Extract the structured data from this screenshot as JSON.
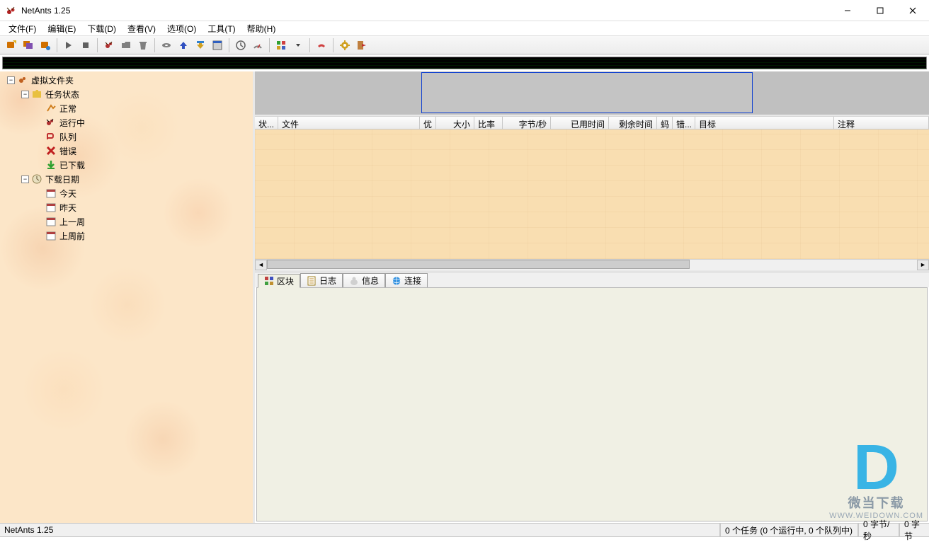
{
  "window": {
    "title": "NetAnts 1.25"
  },
  "menu": {
    "file": "文件(F)",
    "edit": "编辑(E)",
    "download": "下载(D)",
    "view": "查看(V)",
    "options": "选项(O)",
    "tools": "工具(T)",
    "help": "帮助(H)"
  },
  "tree": {
    "root": "虚拟文件夹",
    "task_status": "任务状态",
    "status_items": {
      "normal": "正常",
      "running": "运行中",
      "queued": "队列",
      "error": "错误",
      "downloaded": "已下载"
    },
    "download_date": "下载日期",
    "date_items": {
      "today": "今天",
      "yesterday": "昨天",
      "last_week": "上一周",
      "before_last_week": "上周前"
    }
  },
  "columns": {
    "status": "状...",
    "file": "文件",
    "priority": "优",
    "size": "大小",
    "ratio": "比率",
    "bytes_per_sec": "字节/秒",
    "elapsed": "已用时间",
    "remaining": "剩余时间",
    "ants": "蚂",
    "error": "错...",
    "target": "目标",
    "comment": "注释"
  },
  "bottom_tabs": {
    "blocks": "区块",
    "log": "日志",
    "info": "信息",
    "link": "连接"
  },
  "status": {
    "app": "NetAnts 1.25",
    "tasks": "0 个任务 (0 个运行中, 0 个队列中)",
    "speed": "0 字节/秒",
    "bytes": "0 字节"
  },
  "watermark": {
    "text": "微当下载",
    "url": "WWW.WEIDOWN.COM"
  }
}
